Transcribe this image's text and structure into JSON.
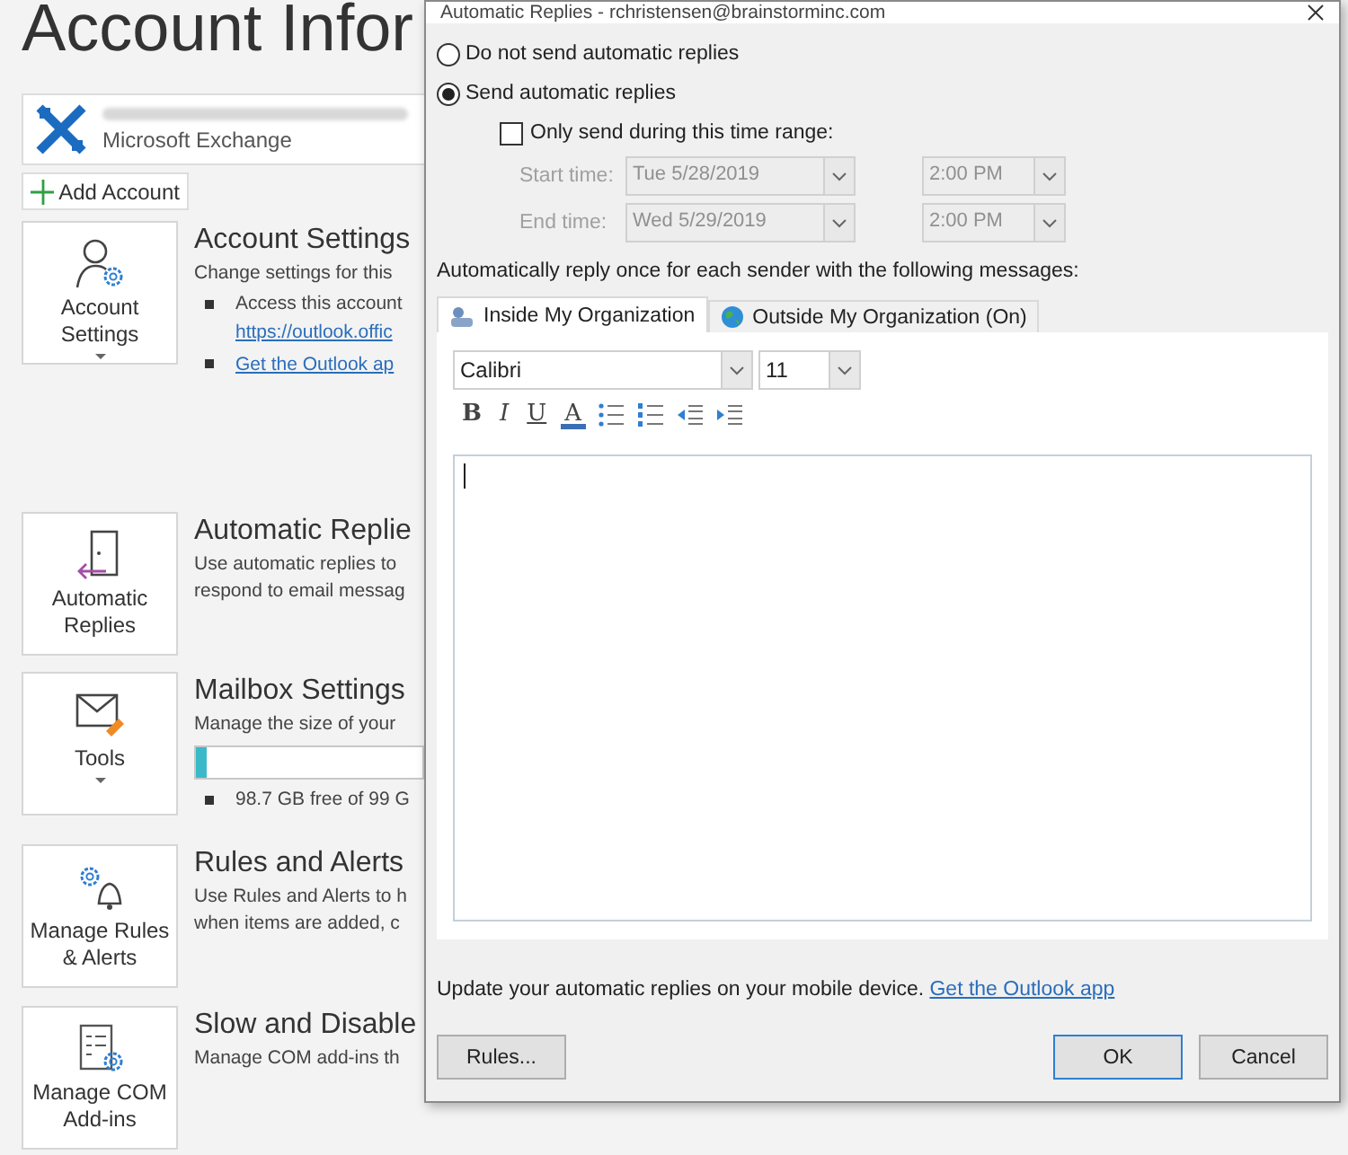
{
  "page": {
    "title": "Account Infor",
    "account": {
      "type": "Microsoft Exchange"
    },
    "add_account": "Add Account",
    "sections": [
      {
        "kind": "account",
        "tile": "Account Settings",
        "tile_caret": true,
        "heading": "Account Settings",
        "lines": [
          "Change settings for this"
        ],
        "bullets": [
          {
            "text": "Access this account",
            "link": "https://outlook.offic"
          },
          {
            "link": "Get the Outlook ap"
          }
        ]
      },
      {
        "kind": "replies",
        "tile": "Automatic Replies",
        "tile_caret": false,
        "heading": "Automatic Replie",
        "lines": [
          "Use automatic replies to",
          "respond to email messag"
        ]
      },
      {
        "kind": "tools",
        "tile": "Tools",
        "tile_caret": true,
        "heading": "Mailbox Settings",
        "lines": [
          "Manage the size of your"
        ],
        "usage": {
          "level": 0.05
        },
        "bullets": [
          {
            "text": "98.7 GB free of 99 G"
          }
        ]
      },
      {
        "kind": "rules",
        "tile": "Manage Rules & Alerts",
        "tile_caret": false,
        "heading": "Rules and Alerts",
        "lines": [
          "Use Rules and Alerts to h",
          "when items are added, c"
        ]
      },
      {
        "kind": "addins",
        "tile": "Manage COM Add-ins",
        "tile_caret": false,
        "heading": "Slow and Disable",
        "lines": [
          "Manage COM add-ins th"
        ]
      }
    ]
  },
  "dialog": {
    "title": "Automatic Replies - rchristensen@brainstorminc.com",
    "radios": [
      {
        "label": "Do not send automatic replies",
        "selected": false
      },
      {
        "label": "Send automatic replies",
        "selected": true
      }
    ],
    "time_range": {
      "label": "Only send during this time range:",
      "checked": false,
      "disabled": true,
      "rows": [
        {
          "label": "Start time:",
          "date": "Tue 5/28/2019",
          "time": "2:00 PM"
        },
        {
          "label": "End time:",
          "date": "Wed 5/29/2019",
          "time": "2:00 PM"
        }
      ]
    },
    "instruction": "Automatically reply once for each sender with the following messages:",
    "tabs": [
      {
        "label": "Inside My Organization",
        "kind": "inside",
        "selected": true
      },
      {
        "label": "Outside My Organization (On)",
        "kind": "outside",
        "selected": false
      }
    ],
    "font": "Calibri",
    "size": "11",
    "format": [
      {
        "kind": "bold",
        "label": "B"
      },
      {
        "kind": "italic",
        "label": "I"
      },
      {
        "kind": "underline",
        "label": "U"
      },
      {
        "kind": "color",
        "label": "A"
      },
      {
        "kind": "bullets"
      },
      {
        "kind": "numbers"
      },
      {
        "kind": "outdent"
      },
      {
        "kind": "indent"
      }
    ],
    "footer": {
      "text": "Update your automatic replies on your mobile device.",
      "link": "Get the Outlook app"
    },
    "buttons": [
      {
        "label": "Rules...",
        "kind": "left"
      },
      {
        "label": "OK",
        "kind": "default"
      },
      {
        "label": "Cancel",
        "kind": "normal"
      }
    ]
  }
}
